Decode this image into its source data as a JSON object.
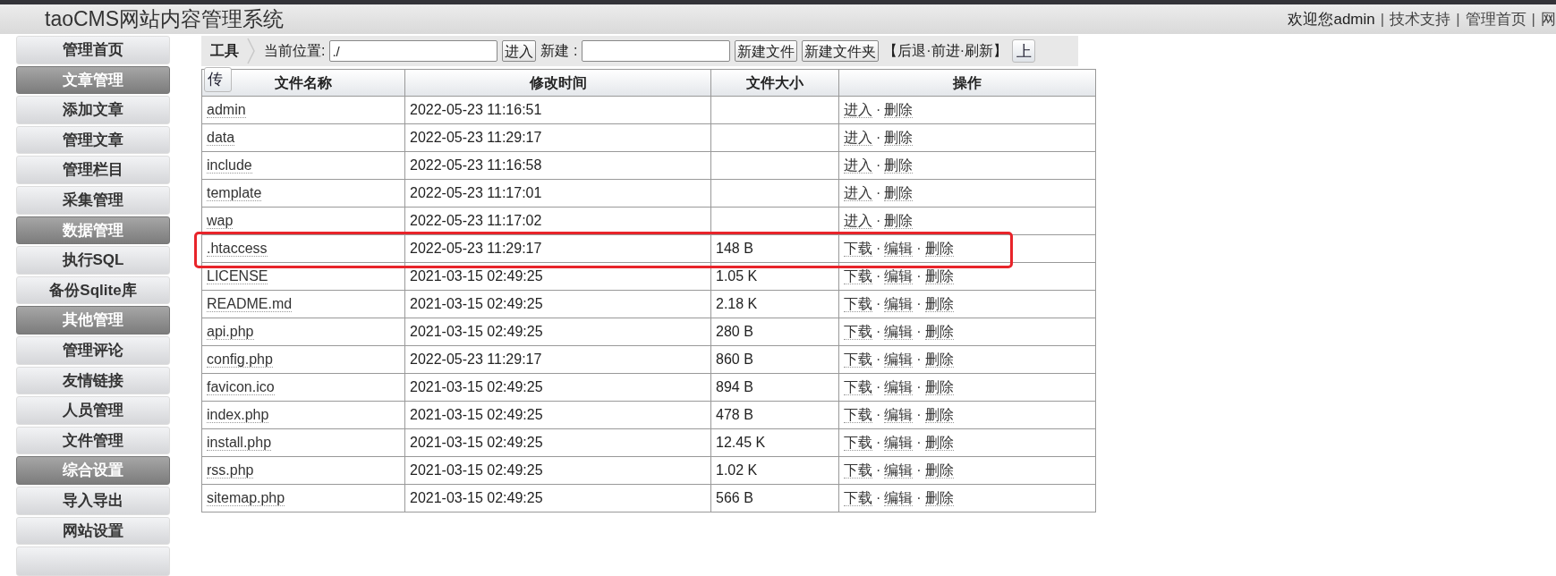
{
  "header": {
    "title": "taoCMS网站内容管理系统",
    "links": [
      {
        "kind": "text",
        "text": "欢迎您admin"
      },
      {
        "kind": "sep",
        "text": "|"
      },
      {
        "kind": "link",
        "text": "技术支持"
      },
      {
        "kind": "sep",
        "text": "|"
      },
      {
        "kind": "link",
        "text": "管理首页"
      },
      {
        "kind": "sep",
        "text": "|"
      },
      {
        "kind": "link",
        "text": "网"
      }
    ]
  },
  "sidebar": {
    "items": [
      {
        "label": "管理首页",
        "kind": "item"
      },
      {
        "label": "文章管理",
        "kind": "section"
      },
      {
        "label": "添加文章",
        "kind": "item"
      },
      {
        "label": "管理文章",
        "kind": "item"
      },
      {
        "label": "管理栏目",
        "kind": "item"
      },
      {
        "label": "采集管理",
        "kind": "item"
      },
      {
        "label": "数据管理",
        "kind": "section"
      },
      {
        "label": "执行SQL",
        "kind": "item"
      },
      {
        "label": "备份Sqlite库",
        "kind": "item"
      },
      {
        "label": "其他管理",
        "kind": "section"
      },
      {
        "label": "管理评论",
        "kind": "item"
      },
      {
        "label": "友情链接",
        "kind": "item"
      },
      {
        "label": "人员管理",
        "kind": "item"
      },
      {
        "label": "文件管理",
        "kind": "item"
      },
      {
        "label": "综合设置",
        "kind": "section"
      },
      {
        "label": "导入导出",
        "kind": "item"
      },
      {
        "label": "网站设置",
        "kind": "item"
      },
      {
        "kind": "partial"
      }
    ]
  },
  "toolbar": {
    "title": "工具",
    "location_label": "当前位置:",
    "location_value": "./",
    "enter_button": "进入",
    "new_label": "新建 :",
    "new_file_button": "新建文件",
    "new_folder_button": "新建文件夹",
    "nav_text": "【后退·前进·刷新】",
    "upload_button_top": "上",
    "upload_button_wrap": "传"
  },
  "table": {
    "columns": [
      "文件名称",
      "修改时间",
      "文件大小",
      "操作"
    ],
    "rows": [
      {
        "name": "admin",
        "modified": "2022-05-23 11:16:51",
        "size": "",
        "highlighted": false,
        "actions": [
          {
            "kind": "link",
            "text": "进入"
          },
          {
            "kind": "sep",
            "text": "·"
          },
          {
            "kind": "link",
            "text": "删除"
          }
        ]
      },
      {
        "name": "data",
        "modified": "2022-05-23 11:29:17",
        "size": "",
        "highlighted": false,
        "actions": [
          {
            "kind": "link",
            "text": "进入"
          },
          {
            "kind": "sep",
            "text": "·"
          },
          {
            "kind": "link",
            "text": "删除"
          }
        ]
      },
      {
        "name": "include",
        "modified": "2022-05-23 11:16:58",
        "size": "",
        "highlighted": false,
        "actions": [
          {
            "kind": "link",
            "text": "进入"
          },
          {
            "kind": "sep",
            "text": "·"
          },
          {
            "kind": "link",
            "text": "删除"
          }
        ]
      },
      {
        "name": "template",
        "modified": "2022-05-23 11:17:01",
        "size": "",
        "highlighted": false,
        "actions": [
          {
            "kind": "link",
            "text": "进入"
          },
          {
            "kind": "sep",
            "text": "·"
          },
          {
            "kind": "link",
            "text": "删除"
          }
        ]
      },
      {
        "name": "wap",
        "modified": "2022-05-23 11:17:02",
        "size": "",
        "highlighted": false,
        "actions": [
          {
            "kind": "link",
            "text": "进入"
          },
          {
            "kind": "sep",
            "text": "·"
          },
          {
            "kind": "link",
            "text": "删除"
          }
        ]
      },
      {
        "name": ".htaccess",
        "modified": "2022-05-23 11:29:17",
        "size": "148 B",
        "highlighted": true,
        "actions": [
          {
            "kind": "link",
            "text": "下载"
          },
          {
            "kind": "sep",
            "text": "·"
          },
          {
            "kind": "link",
            "text": "编辑"
          },
          {
            "kind": "sep",
            "text": "·"
          },
          {
            "kind": "link",
            "text": "删除"
          }
        ]
      },
      {
        "name": "LICENSE",
        "modified": "2021-03-15 02:49:25",
        "size": "1.05 K",
        "highlighted": false,
        "actions": [
          {
            "kind": "link",
            "text": "下载"
          },
          {
            "kind": "sep",
            "text": "·"
          },
          {
            "kind": "link",
            "text": "编辑"
          },
          {
            "kind": "sep",
            "text": "·"
          },
          {
            "kind": "link",
            "text": "删除"
          }
        ]
      },
      {
        "name": "README.md",
        "modified": "2021-03-15 02:49:25",
        "size": "2.18 K",
        "highlighted": false,
        "actions": [
          {
            "kind": "link",
            "text": "下载"
          },
          {
            "kind": "sep",
            "text": "·"
          },
          {
            "kind": "link",
            "text": "编辑"
          },
          {
            "kind": "sep",
            "text": "·"
          },
          {
            "kind": "link",
            "text": "删除"
          }
        ]
      },
      {
        "name": "api.php",
        "modified": "2021-03-15 02:49:25",
        "size": "280 B",
        "highlighted": false,
        "actions": [
          {
            "kind": "link",
            "text": "下载"
          },
          {
            "kind": "sep",
            "text": "·"
          },
          {
            "kind": "link",
            "text": "编辑"
          },
          {
            "kind": "sep",
            "text": "·"
          },
          {
            "kind": "link",
            "text": "删除"
          }
        ]
      },
      {
        "name": "config.php",
        "modified": "2022-05-23 11:29:17",
        "size": "860 B",
        "highlighted": false,
        "actions": [
          {
            "kind": "link",
            "text": "下载"
          },
          {
            "kind": "sep",
            "text": "·"
          },
          {
            "kind": "link",
            "text": "编辑"
          },
          {
            "kind": "sep",
            "text": "·"
          },
          {
            "kind": "link",
            "text": "删除"
          }
        ]
      },
      {
        "name": "favicon.ico",
        "modified": "2021-03-15 02:49:25",
        "size": "894 B",
        "highlighted": false,
        "actions": [
          {
            "kind": "link",
            "text": "下载"
          },
          {
            "kind": "sep",
            "text": "·"
          },
          {
            "kind": "link",
            "text": "编辑"
          },
          {
            "kind": "sep",
            "text": "·"
          },
          {
            "kind": "link",
            "text": "删除"
          }
        ]
      },
      {
        "name": "index.php",
        "modified": "2021-03-15 02:49:25",
        "size": "478 B",
        "highlighted": false,
        "actions": [
          {
            "kind": "link",
            "text": "下载"
          },
          {
            "kind": "sep",
            "text": "·"
          },
          {
            "kind": "link",
            "text": "编辑"
          },
          {
            "kind": "sep",
            "text": "·"
          },
          {
            "kind": "link",
            "text": "删除"
          }
        ]
      },
      {
        "name": "install.php",
        "modified": "2021-03-15 02:49:25",
        "size": "12.45 K",
        "highlighted": false,
        "actions": [
          {
            "kind": "link",
            "text": "下载"
          },
          {
            "kind": "sep",
            "text": "·"
          },
          {
            "kind": "link",
            "text": "编辑"
          },
          {
            "kind": "sep",
            "text": "·"
          },
          {
            "kind": "link",
            "text": "删除"
          }
        ]
      },
      {
        "name": "rss.php",
        "modified": "2021-03-15 02:49:25",
        "size": "1.02 K",
        "highlighted": false,
        "actions": [
          {
            "kind": "link",
            "text": "下载"
          },
          {
            "kind": "sep",
            "text": "·"
          },
          {
            "kind": "link",
            "text": "编辑"
          },
          {
            "kind": "sep",
            "text": "·"
          },
          {
            "kind": "link",
            "text": "删除"
          }
        ]
      },
      {
        "name": "sitemap.php",
        "modified": "2021-03-15 02:49:25",
        "size": "566 B",
        "highlighted": false,
        "actions": [
          {
            "kind": "link",
            "text": "下载"
          },
          {
            "kind": "sep",
            "text": "·"
          },
          {
            "kind": "link",
            "text": "编辑"
          },
          {
            "kind": "sep",
            "text": "·"
          },
          {
            "kind": "link",
            "text": "删除"
          }
        ]
      }
    ]
  }
}
